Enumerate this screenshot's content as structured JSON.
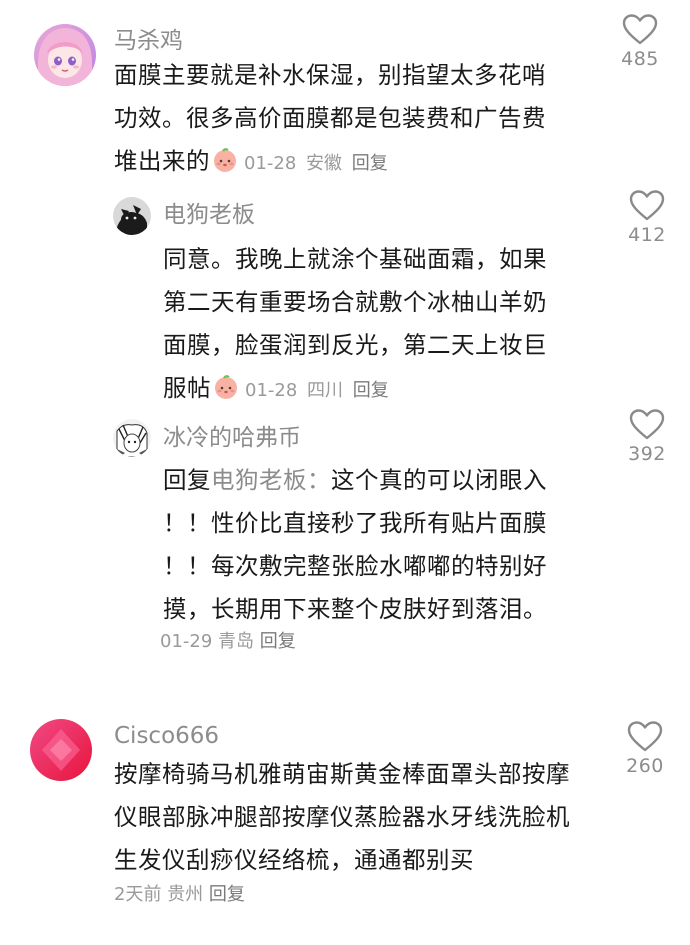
{
  "comments": [
    {
      "username": "马杀鸡",
      "text_lines": [
        "面膜主要就是补水保湿，别指望太多花哨",
        "功效。很多高价面膜都是包装费和广告费",
        "堆出来的"
      ],
      "emoji": "peach-face-emoji",
      "date": "01-28",
      "location": "安徽",
      "reply_label": "回复",
      "likes": "485",
      "avatar": "anime-girl-pink-avatar"
    },
    {
      "username": "电狗老板",
      "text_lines": [
        "同意。我晚上就涂个基础面霜，如果",
        "第二天有重要场合就敷个冰柚山羊奶",
        "面膜，脸蛋润到反光，第二天上妆巨",
        "服帖"
      ],
      "emoji": "peach-face-emoji",
      "date": "01-28",
      "location": "四川",
      "reply_label": "回复",
      "likes": "412",
      "avatar": "black-cat-avatar"
    },
    {
      "username": "冰冷的哈弗币",
      "reply_prefix": "回复",
      "reply_target": "电狗老板：",
      "text_first": "这个真的可以闭眼入",
      "text_lines": [
        "！！性价比直接秒了我所有贴片面膜",
        "！！每次敷完整张脸水嘟嘟的特别好",
        "摸，长期用下来整个皮肤好到落泪。"
      ],
      "date": "01-29",
      "location": "青岛",
      "reply_label": "回复",
      "likes": "392",
      "avatar": "manga-sketch-avatar"
    },
    {
      "username": "Cisco666",
      "text_lines": [
        "按摩椅骑马机雅萌宙斯黄金棒面罩头部按摩",
        "仪眼部脉冲腿部按摩仪蒸脸器水牙线洗脸机",
        "生发仪刮痧仪经络梳，通通都别买"
      ],
      "date": "2天前",
      "location": "贵州",
      "reply_label": "回复",
      "likes": "260",
      "avatar": "pink-red-gradient-avatar"
    }
  ],
  "icons": {
    "like": "heart-outline-icon"
  },
  "colors": {
    "username": "#8c8c8c",
    "text": "#1a1a1a",
    "meta": "#9a9a9a",
    "heart": "#8a8a8a"
  }
}
